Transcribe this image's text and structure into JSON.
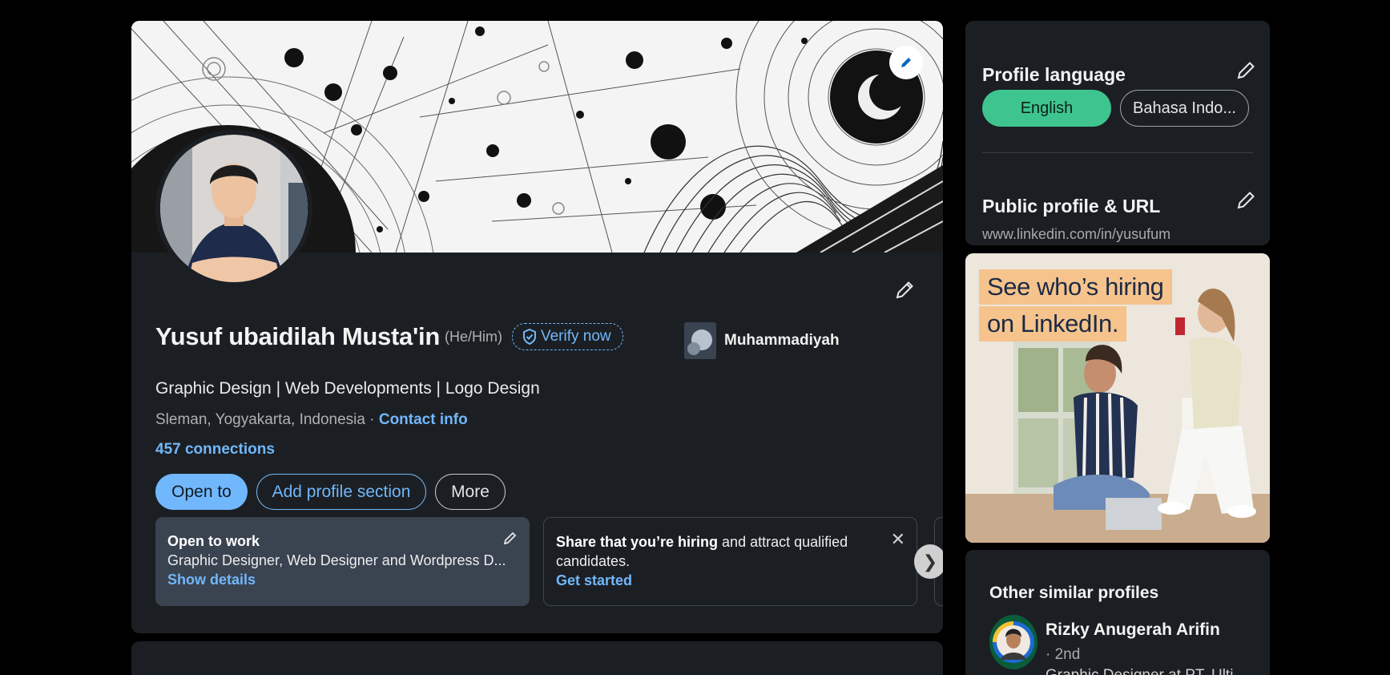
{
  "profile": {
    "name": "Yusuf ubaidilah Musta'in",
    "pronouns": "(He/Him)",
    "verify_label": "Verify now",
    "headline": "Graphic Design | Web Developments | Logo Design",
    "location": "Sleman, Yogyakarta, Indonesia · ",
    "contact_info": "Contact info",
    "connections": "457 connections",
    "company": "Muhammadiyah"
  },
  "actions": {
    "open_to": "Open to",
    "add_section": "Add profile section",
    "more": "More"
  },
  "promos": {
    "open_to_work": {
      "title": "Open to work",
      "text": "Graphic Designer, Web Designer and Wordpress D...",
      "link": "Show details"
    },
    "hiring": {
      "title": "Share that you’re hiring",
      "text_rest": " and attract qualified",
      "text_line2": "candidates.",
      "link": "Get started"
    },
    "next_glyph": "❯",
    "close_glyph": "✕"
  },
  "sidebar": {
    "profile_language": {
      "title": "Profile language",
      "options": [
        "English",
        "Bahasa Indo..."
      ]
    },
    "public_profile": {
      "title": "Public profile & URL",
      "url": "www.linkedin.com/in/yusufum"
    },
    "ad": {
      "line1": "See who’s hiring",
      "line2": "on LinkedIn."
    },
    "similar": {
      "title": "Other similar profiles",
      "name": "Rizky Anugerah Arifin",
      "degree": "· 2nd",
      "subtitle": "Graphic Designer at PT. Ulti..."
    }
  },
  "colors": {
    "background": "#000000",
    "card": "#1b1f23",
    "link": "#71b7fb",
    "accent_green": "#3ec58f",
    "promo_bg": "#3a4350",
    "ad_tag": "#f6c38c"
  },
  "icons": [
    "pencil-icon",
    "shield-check-icon",
    "close-icon",
    "chevron-right-icon"
  ]
}
